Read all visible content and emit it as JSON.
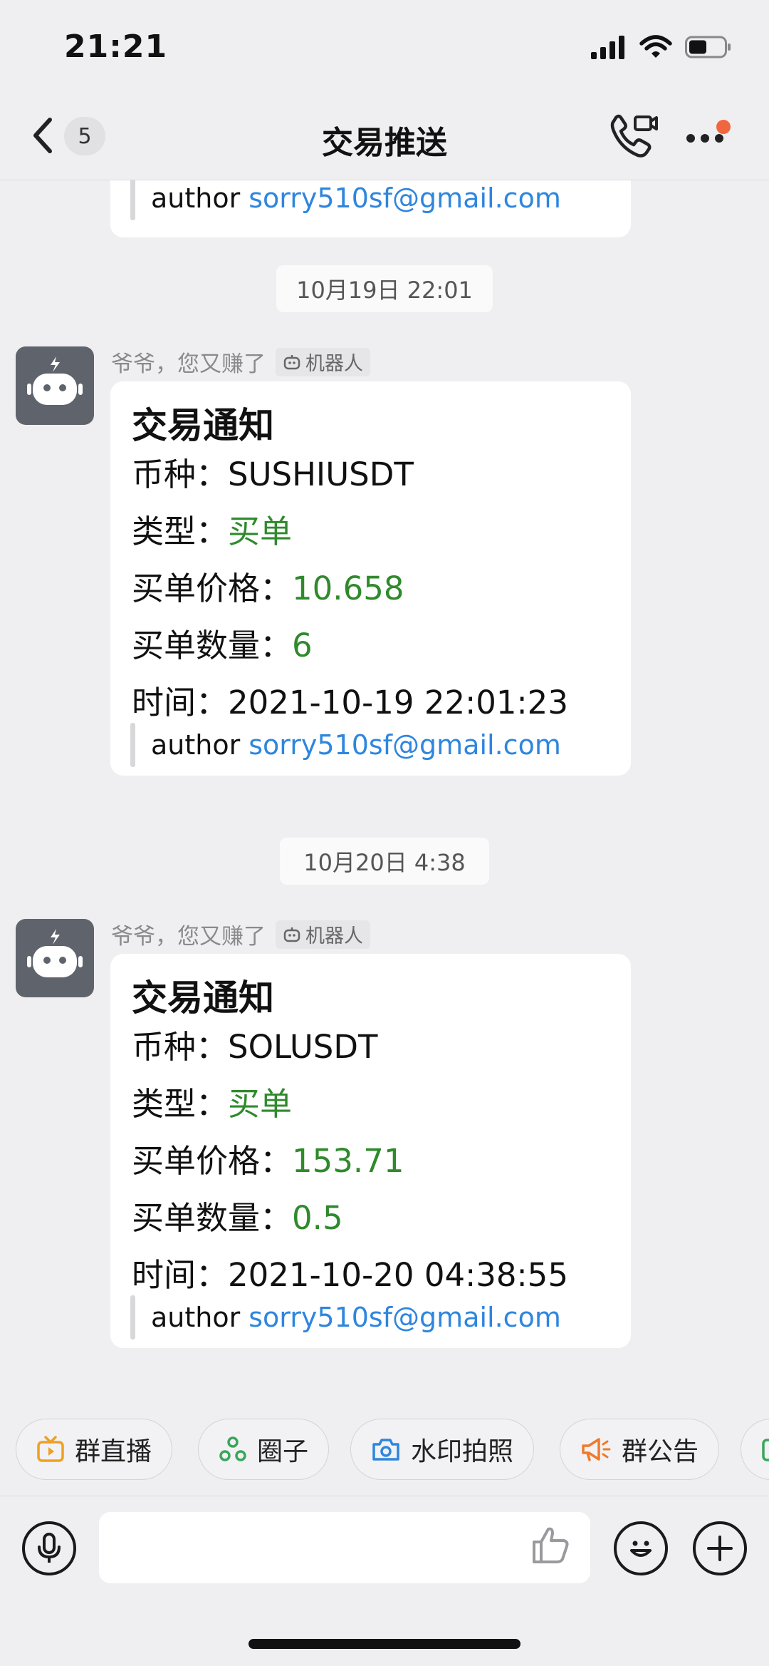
{
  "status_bar": {
    "time": "21:21"
  },
  "header": {
    "unread_count": "5",
    "title": "交易推送"
  },
  "chat": {
    "prev_author": {
      "label": "author",
      "email": "sorry510sf@gmail.com"
    },
    "messages": [
      {
        "timestamp": "10月19日 22:01",
        "sender": "爷爷，您又赚了",
        "bot_tag": "机器人",
        "title": "交易通知",
        "symbol_label": "币种：",
        "symbol": "SUSHIUSDT",
        "type_label": "类型：",
        "type": "买单",
        "price_label": "买单价格：",
        "price": "10.658",
        "qty_label": "买单数量：",
        "qty": "6",
        "time_label": "时间：",
        "time": "2021-10-19 22:01:23",
        "author_label": "author",
        "author_email": "sorry510sf@gmail.com"
      },
      {
        "timestamp": "10月20日 4:38",
        "sender": "爷爷，您又赚了",
        "bot_tag": "机器人",
        "title": "交易通知",
        "symbol_label": "币种：",
        "symbol": "SOLUSDT",
        "type_label": "类型：",
        "type": "买单",
        "price_label": "买单价格：",
        "price": "153.71",
        "qty_label": "买单数量：",
        "qty": "0.5",
        "time_label": "时间：",
        "time": "2021-10-20 04:38:55",
        "author_label": "author",
        "author_email": "sorry510sf@gmail.com"
      }
    ]
  },
  "quick_actions": [
    {
      "label": "群直播",
      "icon": "tv-icon"
    },
    {
      "label": "圈子",
      "icon": "circle-icon"
    },
    {
      "label": "水印拍照",
      "icon": "camera-icon"
    },
    {
      "label": "群公告",
      "icon": "megaphone-icon"
    }
  ],
  "colors": {
    "accent_green": "#2f8a2c",
    "link_blue": "#2e86de",
    "badge_red": "#f0663e"
  }
}
